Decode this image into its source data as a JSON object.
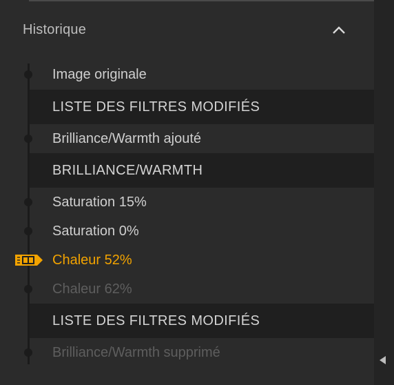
{
  "header": {
    "title": "Historique",
    "collapse_icon": "chevron-up-icon"
  },
  "history": {
    "items": [
      {
        "label": "Image originale",
        "kind": "step",
        "state": "normal"
      },
      {
        "label": "LISTE DES FILTRES MODIFIÉS",
        "kind": "section"
      },
      {
        "label": "Brilliance/Warmth ajouté",
        "kind": "step",
        "state": "normal"
      },
      {
        "label": "BRILLIANCE/WARMTH",
        "kind": "section"
      },
      {
        "label": "Saturation 15%",
        "kind": "step",
        "state": "normal"
      },
      {
        "label": "Saturation 0%",
        "kind": "step",
        "state": "normal"
      },
      {
        "label": "Chaleur 52%",
        "kind": "step",
        "state": "current"
      },
      {
        "label": "Chaleur 62%",
        "kind": "step",
        "state": "dim"
      },
      {
        "label": "LISTE DES FILTRES MODIFIÉS",
        "kind": "section"
      },
      {
        "label": "Brilliance/Warmth supprimé",
        "kind": "step",
        "state": "dim"
      }
    ]
  },
  "colors": {
    "accent": "#f2a300",
    "panel_bg": "#2b2b2b",
    "section_bg": "#1f1f1f",
    "text": "#cfcfcf",
    "text_dim": "#5e5e5e"
  },
  "icons": {
    "current_marker": "compare-marker-icon",
    "scroll": "scroll-left-arrow-icon"
  }
}
